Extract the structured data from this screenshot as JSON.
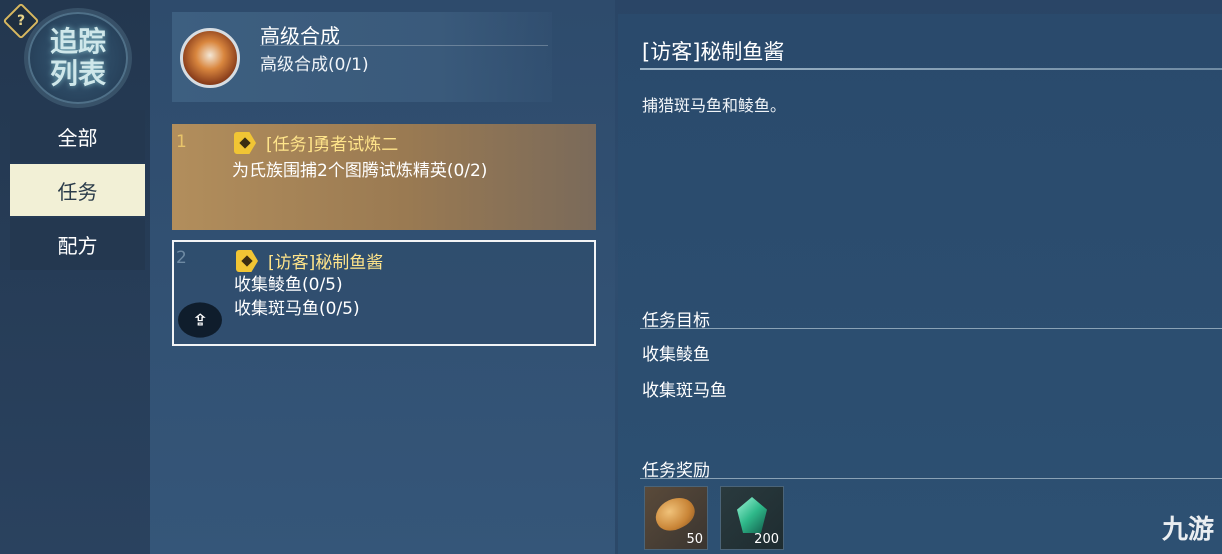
{
  "sidebar": {
    "help_icon": "?",
    "emblem": {
      "line1": "追踪",
      "line2": "列表"
    },
    "items": [
      {
        "label": "全部",
        "active": false
      },
      {
        "label": "任务",
        "active": true
      },
      {
        "label": "配方",
        "active": false
      }
    ]
  },
  "header_card": {
    "title": "高级合成",
    "progress": "高级合成(0/1)"
  },
  "quests": [
    {
      "number": "1",
      "title": "[任务]勇者试炼二",
      "lines": [
        "为氏族围捕2个图腾试炼精英(0/2)"
      ]
    },
    {
      "number": "2",
      "title": "[访客]秘制鱼酱",
      "lines": [
        "收集鲮鱼(0/5)",
        "收集斑马鱼(0/5)"
      ]
    }
  ],
  "detail": {
    "title": "[访客]秘制鱼酱",
    "description": "捕猎斑马鱼和鲮鱼。",
    "objectives_label": "任务目标",
    "objectives": [
      "收集鲮鱼",
      "收集斑马鱼"
    ],
    "rewards_label": "任务奖励",
    "rewards": [
      {
        "icon": "bread-icon",
        "count": "50"
      },
      {
        "icon": "gem-icon",
        "count": "200"
      }
    ]
  },
  "watermark": "九游"
}
